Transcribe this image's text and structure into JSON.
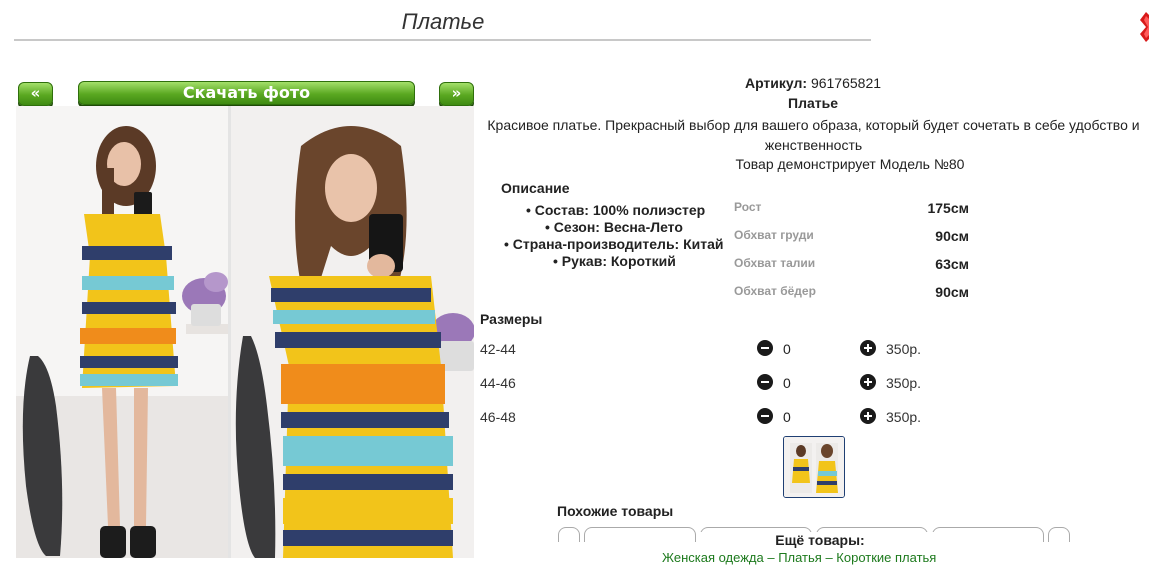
{
  "header": {
    "title": "Платье"
  },
  "gallery": {
    "prev_label": "«",
    "download_label": "Скачать фото",
    "next_label": "»"
  },
  "product": {
    "article_label": "Артикул:",
    "article_value": "961765821",
    "name": "Платье",
    "description": "Красивое платье. Прекрасный выбор для вашего образа, который будет сочетать в себе удобство и женственность",
    "model_line": "Товар демонстрирует Модель №80"
  },
  "details": {
    "heading": "Описание",
    "attributes": [
      "• Состав: 100% полиэстер",
      "• Сезон: Весна-Лето",
      "• Страна-производитель: Китай",
      "• Рукав: Короткий"
    ]
  },
  "measurements": [
    {
      "label": "Рост",
      "value": "175см"
    },
    {
      "label": "Обхват груди",
      "value": "90см"
    },
    {
      "label": "Обхват талии",
      "value": "63см"
    },
    {
      "label": "Обхват бёдер",
      "value": "90см"
    }
  ],
  "sizes": {
    "heading": "Размеры",
    "rows": [
      {
        "size": "42-44",
        "qty": "0",
        "price": "350р."
      },
      {
        "size": "44-46",
        "qty": "0",
        "price": "350р."
      },
      {
        "size": "46-48",
        "qty": "0",
        "price": "350р."
      }
    ]
  },
  "similar": {
    "heading": "Похожие товары"
  },
  "more": {
    "heading": "Ещё товары:",
    "links": "Женская одежда – Платья – Короткие платья"
  },
  "colors": {
    "accent_green": "#5aa821",
    "link_green": "#1d7a1d",
    "thumb_border": "#1f3f73"
  },
  "icons": [
    "minus-circle-icon",
    "plus-circle-icon",
    "red-corner-icon"
  ]
}
